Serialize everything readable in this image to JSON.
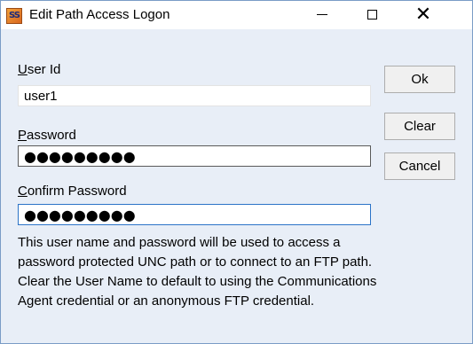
{
  "window": {
    "title": "Edit Path Access Logon",
    "icon_text": "SS",
    "controls": {
      "minimize": "minimize-icon",
      "maximize": "maximize-icon",
      "close": "close-icon"
    }
  },
  "form": {
    "user_id": {
      "label_accel": "U",
      "label_rest": "ser Id",
      "value": "user1"
    },
    "password": {
      "label_accel": "P",
      "label_rest": "assword",
      "value": "●●●●●●●●●"
    },
    "confirm": {
      "label_accel": "C",
      "label_rest": "onfirm Password",
      "value": "●●●●●●●●●"
    }
  },
  "buttons": {
    "ok": "Ok",
    "clear": "Clear",
    "cancel": "Cancel"
  },
  "info_lines": [
    "This user name and password will be used to access a",
    "password protected UNC path or to connect to an FTP path.",
    "Clear the User Name to default to using the Communications",
    "Agent credential or an anonymous FTP credential."
  ],
  "colors": {
    "window_bg": "#e8eef7",
    "focus_border": "#2b73c7",
    "frame": "#7a9cc6"
  }
}
